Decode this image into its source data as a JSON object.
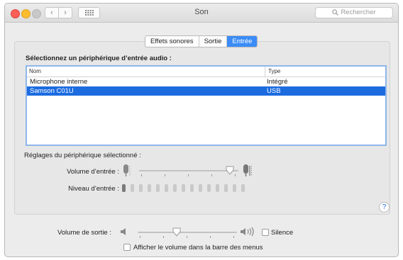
{
  "window": {
    "title": "Son"
  },
  "search": {
    "placeholder": "Rechercher"
  },
  "tabs": [
    {
      "label": "Effets sonores",
      "active": false
    },
    {
      "label": "Sortie",
      "active": false
    },
    {
      "label": "Entrée",
      "active": true
    }
  ],
  "input": {
    "heading": "Sélectionnez un périphérique d’entrée audio :",
    "columns": {
      "name": "Nom",
      "type": "Type"
    },
    "devices": [
      {
        "name": "Microphone interne",
        "type": "Intégré",
        "selected": false
      },
      {
        "name": "Samson C01U",
        "type": "USB",
        "selected": true
      }
    ],
    "settings_label": "Réglages du périphérique sélectionné :",
    "volume_label": "Volume d’entrée :",
    "volume_level": 0.95,
    "level_label": "Niveau d’entrée :",
    "level_bars_total": 15,
    "level_bars_lit": 1
  },
  "output": {
    "volume_label": "Volume de sortie :",
    "volume_level": 0.38,
    "mute_label": "Silence",
    "mute_checked": false,
    "menubar_label": "Afficher le volume dans la barre des menus",
    "menubar_checked": false
  },
  "help": {
    "label": "?"
  },
  "icons": [
    "back-icon",
    "forward-icon",
    "grid-icon",
    "search-icon",
    "microphone-low-icon",
    "microphone-high-icon",
    "speaker-low-icon",
    "speaker-high-icon",
    "help-icon"
  ]
}
